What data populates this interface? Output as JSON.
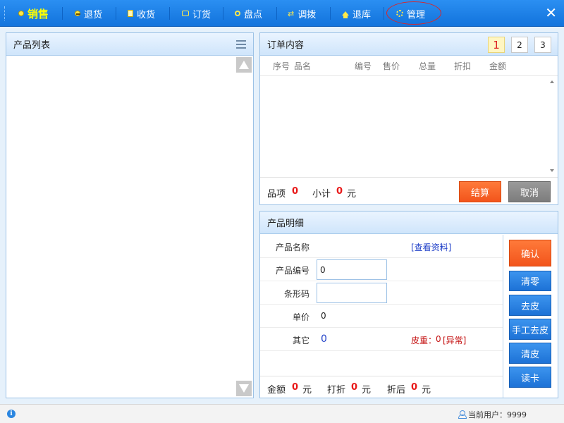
{
  "toolbar": {
    "items": [
      {
        "label": "销售",
        "icon": "yellow-dot-icon",
        "active": true
      },
      {
        "label": "退货",
        "icon": "minus-circle-icon"
      },
      {
        "label": "收货",
        "icon": "document-icon"
      },
      {
        "label": "订货",
        "icon": "chat-icon"
      },
      {
        "label": "盘点",
        "icon": "search-icon"
      },
      {
        "label": "调拨",
        "icon": "transfer-arrows-icon"
      },
      {
        "label": "退库",
        "icon": "home-icon"
      },
      {
        "label": "管理",
        "icon": "gear-icon",
        "highlighted": true
      }
    ],
    "close_glyph": "✕"
  },
  "product_list": {
    "title": "产品列表"
  },
  "order": {
    "title": "订单内容",
    "pages": [
      "1",
      "2",
      "3"
    ],
    "active_page": "1",
    "columns": [
      "序号",
      "品名",
      "编号",
      "售价",
      "总量",
      "折扣",
      "金额"
    ],
    "rows": [],
    "item_count_label": "品项",
    "item_count": "0",
    "subtotal_label": "小计",
    "subtotal": "0",
    "currency": "元",
    "checkout_label": "结算",
    "cancel_label": "取消"
  },
  "detail": {
    "title": "产品明细",
    "name_label": "产品名称",
    "view_info_link": "[查看资料]",
    "code_label": "产品编号",
    "code_value": "0",
    "barcode_label": "条形码",
    "barcode_value": "",
    "price_label": "单价",
    "price_value": "0",
    "other_label": "其它",
    "other_value": "0",
    "tare_label": "皮重：",
    "tare_value": "0",
    "abnormal_link": "[异常]",
    "amount_label": "金额",
    "amount_value": "0",
    "discount_label": "打折",
    "discount_value": "0",
    "after_discount_label": "折后",
    "after_discount_value": "0",
    "currency": "元"
  },
  "actions": {
    "confirm": "确认",
    "clear_zero": "清零",
    "tare": "去皮",
    "manual_tare": "手工去皮",
    "clear_tare": "清皮",
    "read_card": "读卡"
  },
  "status": {
    "info_glyph": "i",
    "user_label": "当前用户：",
    "user_value": "9999"
  },
  "colors": {
    "toolbar_blue": "#1a7fe6",
    "active_yellow": "#ffff00",
    "orange_button": "#f2541b",
    "blue_button": "#1d72d6",
    "gray_button": "#7c7c7c",
    "red_number": "#e81818",
    "highlight_ring": "#d8262a"
  }
}
